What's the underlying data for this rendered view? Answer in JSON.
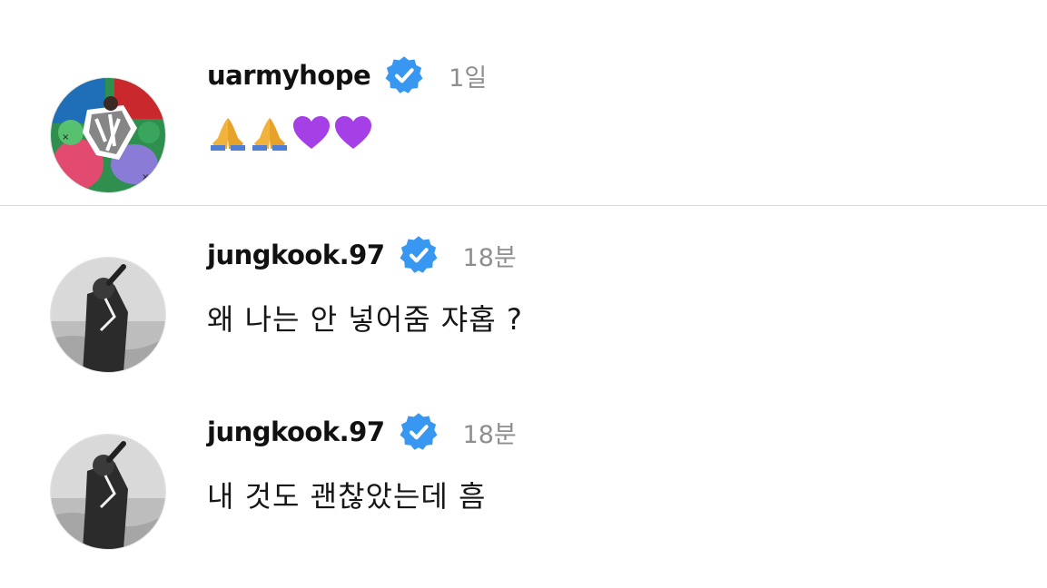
{
  "comments": [
    {
      "username": "uarmyhope",
      "verified": true,
      "time": "1일",
      "text": "🙏🙏💜💜",
      "emojis": [
        "folded-hands",
        "folded-hands",
        "purple-heart",
        "purple-heart"
      ]
    },
    {
      "username": "jungkook.97",
      "verified": true,
      "time": "18분",
      "text": "왜 나는 안 넣어줌 쟈홉 ?"
    },
    {
      "username": "jungkook.97",
      "verified": true,
      "time": "18분",
      "text": "내 것도 괜찮았는데 흠"
    }
  ],
  "colors": {
    "verified_badge": "#3897f0",
    "time_text": "#8e8e8e",
    "divider": "#dbdbdb",
    "purple_heart": "#a53fe6"
  },
  "icons": [
    "verified-badge-icon",
    "folded-hands-icon",
    "purple-heart-icon"
  ]
}
